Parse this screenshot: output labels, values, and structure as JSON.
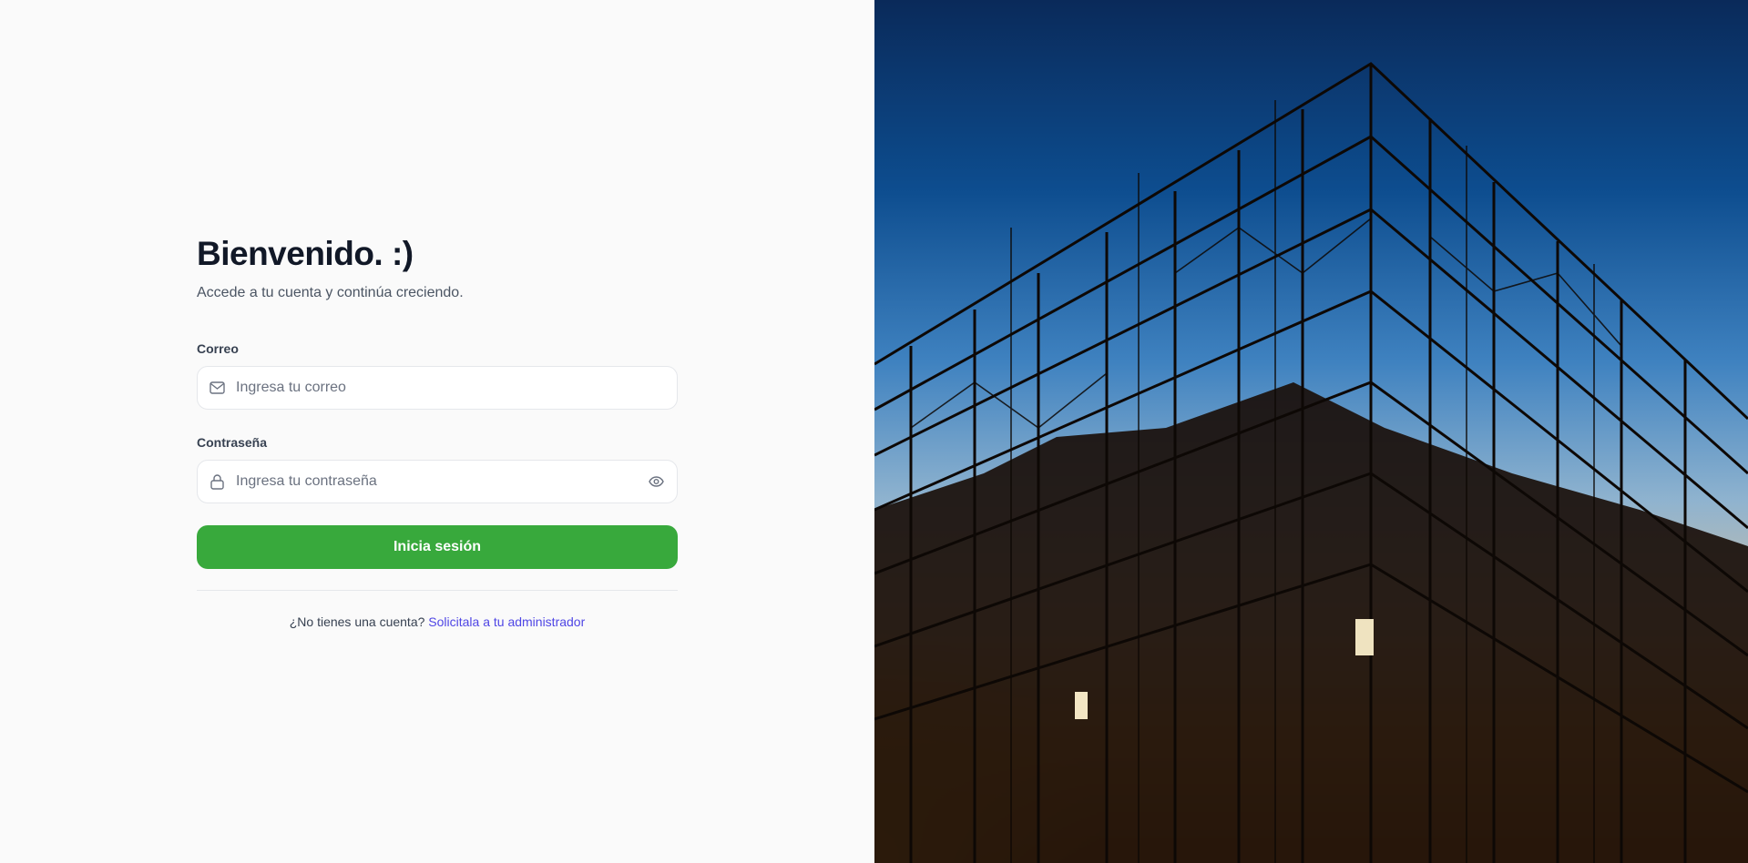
{
  "login": {
    "title": "Bienvenido. :)",
    "subtitle": "Accede a tu cuenta y continúa creciendo.",
    "email": {
      "label": "Correo",
      "placeholder": "Ingresa tu correo",
      "value": "",
      "icon": "mail-icon"
    },
    "password": {
      "label": "Contraseña",
      "placeholder": "Ingresa tu contraseña",
      "value": "",
      "icon": "lock-icon",
      "toggle_icon": "eye-icon"
    },
    "submit_label": "Inicia sesión",
    "footer_text": "¿No tienes una cuenta?",
    "footer_link": "Solicitala a tu administrador"
  },
  "colors": {
    "primary": "#38a93c",
    "link": "#4f46e5",
    "background": "#fafafa"
  },
  "hero": {
    "image": "construction-scaffolding-silhouette-at-sunset"
  }
}
